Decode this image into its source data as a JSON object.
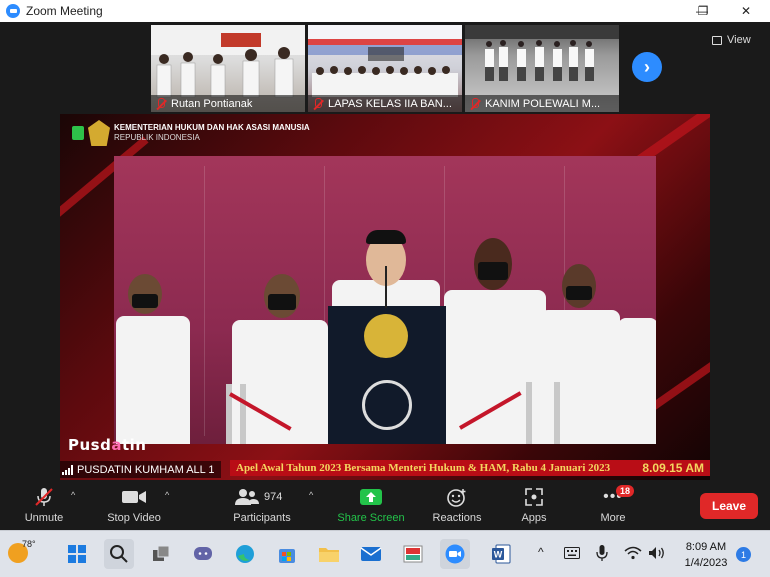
{
  "window": {
    "title": "Zoom Meeting",
    "minimize": "—",
    "maximize": "❐",
    "close": "✕"
  },
  "thumbnails": [
    {
      "label": "Rutan Pontianak"
    },
    {
      "label": "LAPAS KELAS IIA BAN..."
    },
    {
      "label": "KANIM POLEWALI M..."
    }
  ],
  "view_button": "View",
  "video": {
    "ministry_line1": "KEMENTERIAN HUKUM DAN HAK ASASI MANUSIA",
    "ministry_line2": "REPUBLIK INDONESIA",
    "overlay_logo_pre": "Pusd",
    "overlay_logo_o": "a",
    "overlay_logo_post": "tin",
    "ticker_text": "Apel Awal Tahun 2023 Bersama Menteri Hukum & HAM, Rabu 4 Januari 2023",
    "overlay_clock": "8.09.15 AM",
    "speaker_name": "PUSDATIN KUMHAM ALL 1"
  },
  "toolbar": {
    "unmute": "Unmute",
    "stop_video": "Stop Video",
    "participants": "Participants",
    "participants_count": "974",
    "share_screen": "Share Screen",
    "reactions": "Reactions",
    "apps": "Apps",
    "more": "More",
    "more_badge": "18",
    "leave": "Leave"
  },
  "taskbar": {
    "temperature": "78°",
    "time": "8:09 AM",
    "date": "1/4/2023",
    "notification_count": "1"
  },
  "colors": {
    "zoom_blue": "#2d8cff",
    "leave_red": "#e02828",
    "share_green": "#23c34a",
    "ticker_red": "#b90d16"
  }
}
